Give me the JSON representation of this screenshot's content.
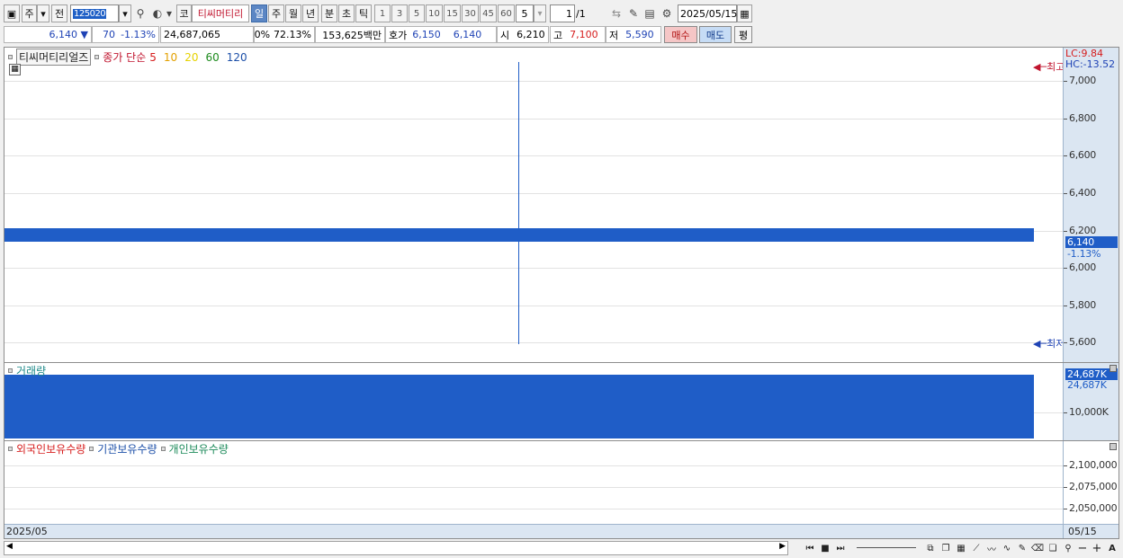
{
  "toolbar": {
    "type_label": "주",
    "jeon_label": "전",
    "code": "125020",
    "co_label": "코",
    "stock_name": "티씨머티리",
    "periods": [
      "일",
      "주",
      "월",
      "년",
      "분",
      "초",
      "틱"
    ],
    "active_period": "일",
    "intervals": [
      "1",
      "3",
      "5",
      "10",
      "15",
      "30",
      "45",
      "60"
    ],
    "count_value": "5",
    "page_current": "1",
    "page_total": "/1",
    "date": "2025/05/15"
  },
  "quote": {
    "price": "6,140",
    "arrow": "▼",
    "change": "70",
    "change_pct": "-1.13%",
    "volume": "24,687,065",
    "zero_pct": "0%",
    "ratio": "72.13%",
    "amount": "153,625백만",
    "hoga_label": "호가",
    "ask": "6,150",
    "bid": "6,140",
    "open_label": "시",
    "open": "6,210",
    "high_label": "고",
    "high": "7,100",
    "low_label": "저",
    "low": "5,590",
    "buy_label": "매수",
    "sell_label": "매도",
    "avg_label": "평"
  },
  "price_pane": {
    "name": "티씨머티리얼즈",
    "ma_title": "종가 단순",
    "ma_periods": [
      "5",
      "10",
      "20",
      "60",
      "120"
    ],
    "ma_colors": [
      "#d61c1c",
      "#e3a000",
      "#e6d200",
      "#1c8a1c",
      "#1c4fa8"
    ],
    "lc_label": "LC:9.84",
    "hc_label": "HC:-13.52",
    "max_label": "최고",
    "min_label": "최저",
    "ticks": [
      "7,000",
      "6,800",
      "6,600",
      "6,400",
      "6,200",
      "6,000",
      "5,800",
      "5,600"
    ],
    "tag_price": "6,140",
    "tag_pct": "-1.13%"
  },
  "volume_pane": {
    "title": "거래량",
    "tag_value": "24,687K",
    "sub_value": "24,687K",
    "ticks": [
      "10,000K"
    ]
  },
  "holdings_pane": {
    "legends": [
      "외국인보유수량",
      "기관보유수량",
      "개인보유수량"
    ],
    "legend_colors": [
      "#d61c1c",
      "#1c4fa8",
      "#1c8a5a"
    ],
    "ticks": [
      "2,100,000",
      "2,075,000",
      "2,050,000"
    ]
  },
  "date_axis": {
    "left": "2025/05",
    "right": "05/15"
  },
  "chart_data": {
    "type": "bar",
    "categories": [
      "05/15"
    ],
    "series": [
      {
        "name": "종가",
        "values": [
          6140
        ]
      },
      {
        "name": "거래량",
        "values": [
          24687065
        ]
      }
    ],
    "open": 6210,
    "high": 7100,
    "low": 5590,
    "close": 6140,
    "ylim": [
      5500,
      7100
    ]
  }
}
